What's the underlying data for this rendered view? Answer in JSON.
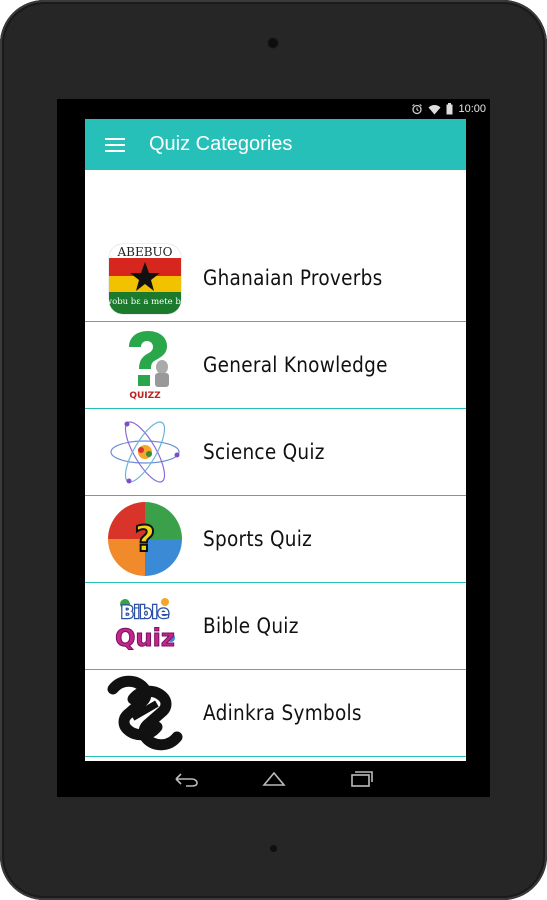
{
  "status_bar": {
    "time": "10:00"
  },
  "app_bar": {
    "title": "Quiz Categories"
  },
  "categories": [
    {
      "label": "Ghanaian Proverbs",
      "thumb_text_top": "ABEBUO",
      "thumb_text_bottom": "wobu bɛ a mete bɛ"
    },
    {
      "label": "General Knowledge",
      "thumb_text": "QUIZZ"
    },
    {
      "label": "Science Quiz"
    },
    {
      "label": "Sports Quiz"
    },
    {
      "label": "Bible Quiz",
      "thumb_text_top": "Bible",
      "thumb_text_bottom": "Quiz"
    },
    {
      "label": "Adinkra Symbols"
    }
  ],
  "colors": {
    "accent": "#26c0b9",
    "bezel": "#262626"
  }
}
